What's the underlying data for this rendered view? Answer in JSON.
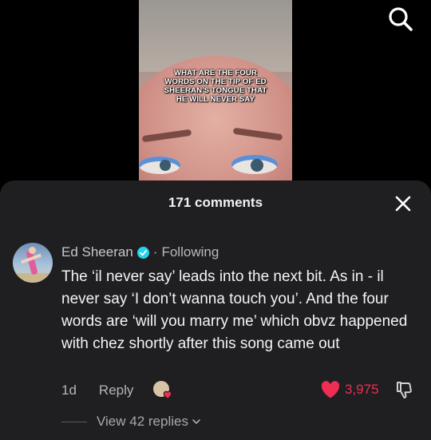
{
  "video": {
    "caption": "WHAT ARE THE FOUR WORDS ON THE TIP OF ED SHEERAN'S TONGUE THAT HE WILL NEVER SAY"
  },
  "sheet": {
    "title": "171 comments"
  },
  "comment": {
    "username": "Ed Sheeran",
    "separator": "·",
    "follow_status": "Following",
    "text": "The ‘il never say’ leads into the next bit. As in - il never say ‘I don’t wanna touch you’. And the four words are ‘will you marry me’ which obvz happened with chez shortly after this song came out",
    "age": "1d",
    "reply_label": "Reply",
    "likes": "3,975",
    "view_replies": "View 42 replies"
  },
  "icons": {
    "search": "search-icon",
    "close": "close-icon",
    "verified": "verified-badge-icon",
    "heart": "heart-icon",
    "dislike": "thumbs-down-icon",
    "chevron": "chevron-down-icon"
  },
  "colors": {
    "sheet_bg": "#1f1f21",
    "like_red": "#ee2e52",
    "verified_blue": "#20d5ec"
  }
}
